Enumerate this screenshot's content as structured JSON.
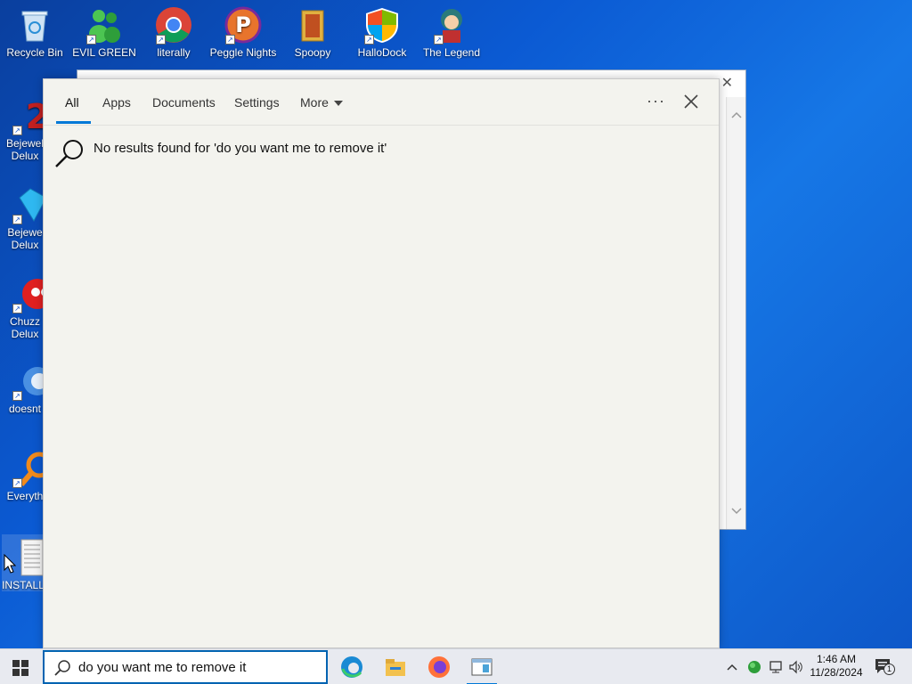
{
  "desktop": {
    "top_icons": [
      {
        "label": "Recycle Bin",
        "icon": "recycle-bin-icon",
        "color": "#9fc6e8"
      },
      {
        "label": "EVIL GREEN",
        "icon": "green-figures-icon",
        "color": "#3cb043"
      },
      {
        "label": "literally",
        "icon": "chrome-icon",
        "color": "#db4437"
      },
      {
        "label": "Peggle Nights",
        "icon": "peggle-icon",
        "color": "#e8742c"
      },
      {
        "label": "Spoopy",
        "icon": "folder-icon",
        "color": "#e0b040"
      },
      {
        "label": "HalloDock",
        "icon": "windows-shield-icon",
        "color": "#f25022"
      },
      {
        "label": "The Legend",
        "icon": "character-icon",
        "color": "#2a7a7a"
      }
    ],
    "left_icons": [
      {
        "label": "Bejewel",
        "sub": "Delux",
        "icon": "bejeweled-2-icon",
        "color": "#c02020"
      },
      {
        "label": "Bejewe",
        "sub": "Delux",
        "icon": "diamond-icon",
        "color": "#2fb8f0"
      },
      {
        "label": "Chuzz",
        "sub": "Delux",
        "icon": "chuzzle-icon",
        "color": "#e02020"
      },
      {
        "label": "doesnt",
        "sub": "",
        "icon": "globe-icon",
        "color": "#4a90e2"
      },
      {
        "label": "Everyth",
        "sub": "",
        "icon": "everything-search-icon",
        "color": "#f08a1c"
      },
      {
        "label": "INSTALL",
        "sub": "",
        "icon": "text-file-icon",
        "color": "#f0f0f0"
      }
    ]
  },
  "search_panel": {
    "tabs": [
      {
        "label": "All"
      },
      {
        "label": "Apps"
      },
      {
        "label": "Documents"
      },
      {
        "label": "Settings"
      },
      {
        "label": "More"
      }
    ],
    "more_options": "···",
    "result_text": "No results found for 'do you want me to remove it'"
  },
  "taskbar": {
    "search_value": "do you want me to remove it",
    "clock_time": "1:46 AM",
    "clock_date": "11/28/2024",
    "notification_count": "1",
    "accent": "#0078d7"
  }
}
